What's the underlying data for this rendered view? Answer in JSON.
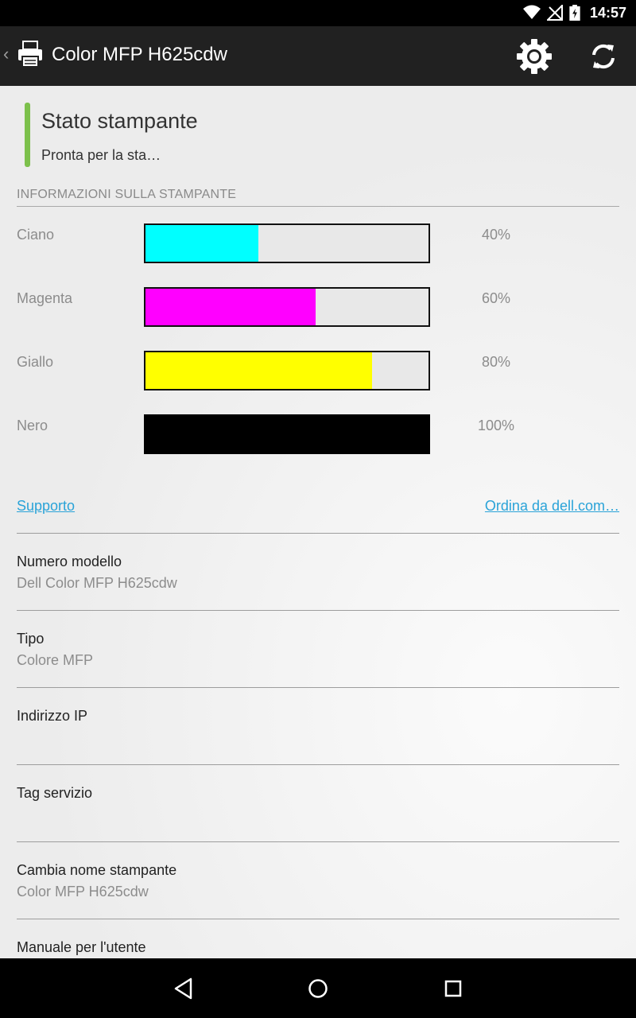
{
  "status_bar": {
    "time": "14:57"
  },
  "app": {
    "title": "Color MFP H625cdw",
    "icons": {
      "printer": "printer-icon",
      "settings": "gear-icon",
      "refresh": "refresh-icon"
    }
  },
  "printer_status": {
    "title": "Stato stampante",
    "value": "Pronta per la sta…",
    "accent_color": "#7cc04b"
  },
  "section": {
    "title": "INFORMAZIONI SULLA STAMPANTE"
  },
  "toners": [
    {
      "label": "Ciano",
      "percent_text": "40%",
      "level": 0.4,
      "color": "#00ffff"
    },
    {
      "label": "Magenta",
      "percent_text": "60%",
      "level": 0.6,
      "color": "#ff00ff"
    },
    {
      "label": "Giallo",
      "percent_text": "80%",
      "level": 0.8,
      "color": "#ffff00"
    },
    {
      "label": "Nero",
      "percent_text": "100%",
      "level": 1.0,
      "color": "#000000"
    }
  ],
  "links": {
    "support": "Supporto",
    "order": "Ordina da dell.com…"
  },
  "info_items": [
    {
      "label": "Numero modello",
      "value": "Dell Color MFP H625cdw"
    },
    {
      "label": "Tipo",
      "value": "Colore MFP"
    },
    {
      "label": "Indirizzo IP",
      "value": ""
    },
    {
      "label": "Tag servizio",
      "value": ""
    },
    {
      "label": "Cambia nome stampante",
      "value": "Color MFP H625cdw"
    },
    {
      "label": "Manuale per l'utente",
      "value": ""
    }
  ],
  "nav": {
    "back": "back-icon",
    "home": "home-icon",
    "recents": "recents-icon"
  }
}
